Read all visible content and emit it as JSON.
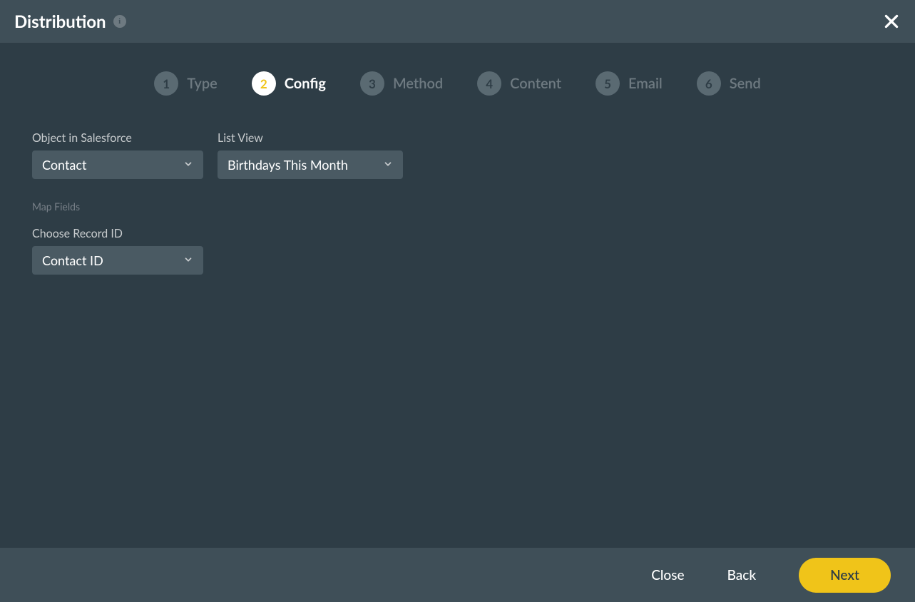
{
  "header": {
    "title": "Distribution"
  },
  "stepper": {
    "steps": [
      {
        "num": "1",
        "label": "Type",
        "active": false
      },
      {
        "num": "2",
        "label": "Config",
        "active": true
      },
      {
        "num": "3",
        "label": "Method",
        "active": false
      },
      {
        "num": "4",
        "label": "Content",
        "active": false
      },
      {
        "num": "5",
        "label": "Email",
        "active": false
      },
      {
        "num": "6",
        "label": "Send",
        "active": false
      }
    ]
  },
  "form": {
    "object_label": "Object in Salesforce",
    "object_value": "Contact",
    "listview_label": "List View",
    "listview_value": "Birthdays This Month",
    "mapfields_label": "Map Fields",
    "recordid_label": "Choose Record ID",
    "recordid_value": "Contact ID"
  },
  "footer": {
    "close": "Close",
    "back": "Back",
    "next": "Next"
  }
}
